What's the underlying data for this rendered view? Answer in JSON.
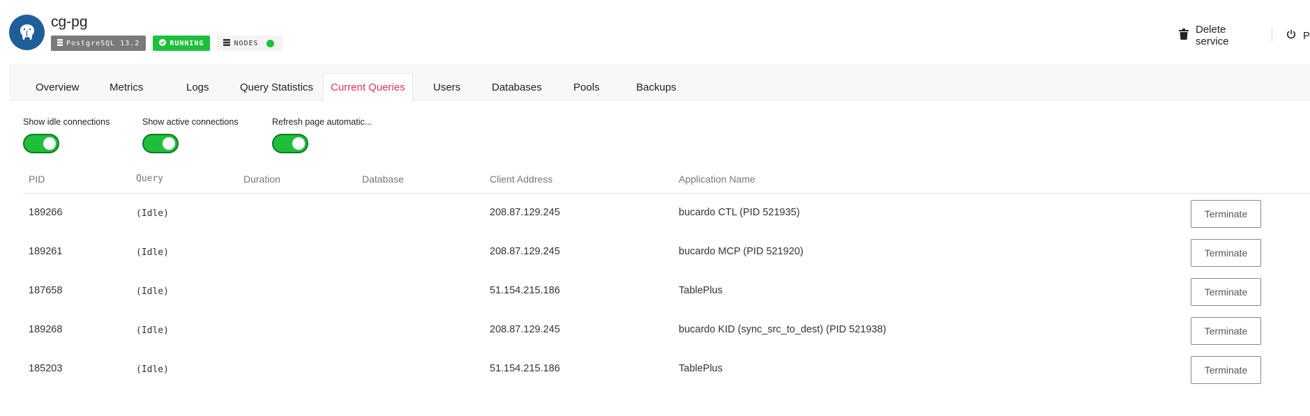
{
  "service": {
    "title": "cg-pg",
    "badges": {
      "version": "PostgreSQL 13.2",
      "status": "RUNNING",
      "nodes": "NODES"
    },
    "colors": {
      "accent": "#e8315a",
      "running": "#1fbf3c",
      "avatar": "#1e5f99"
    }
  },
  "actions": {
    "delete_label": "Delete service",
    "power_label": "P"
  },
  "tabs": [
    {
      "label": "Overview"
    },
    {
      "label": "Metrics"
    },
    {
      "label": "Logs"
    },
    {
      "label": "Query Statistics"
    },
    {
      "label": "Current Queries",
      "active": true
    },
    {
      "label": "Users"
    },
    {
      "label": "Databases"
    },
    {
      "label": "Pools"
    },
    {
      "label": "Backups"
    }
  ],
  "toggles": [
    {
      "label": "Show idle connections",
      "on": true
    },
    {
      "label": "Show active connections",
      "on": true
    },
    {
      "label": "Refresh page automatic...",
      "on": true
    }
  ],
  "table": {
    "columns": {
      "pid": "PID",
      "query": "Query",
      "duration": "Duration",
      "database": "Database",
      "client_address": "Client Address",
      "application_name": "Application Name"
    },
    "rows": [
      {
        "pid": "189266",
        "query": "(Idle)",
        "duration": "",
        "database": "",
        "client_address": "208.87.129.245",
        "application_name": "bucardo CTL (PID 521935)",
        "action": "Terminate"
      },
      {
        "pid": "189261",
        "query": "(Idle)",
        "duration": "",
        "database": "",
        "client_address": "208.87.129.245",
        "application_name": "bucardo MCP (PID 521920)",
        "action": "Terminate"
      },
      {
        "pid": "187658",
        "query": "(Idle)",
        "duration": "",
        "database": "",
        "client_address": "51.154.215.186",
        "application_name": "TablePlus",
        "action": "Terminate"
      },
      {
        "pid": "189268",
        "query": "(Idle)",
        "duration": "",
        "database": "",
        "client_address": "208.87.129.245",
        "application_name": "bucardo KID (sync_src_to_dest) (PID 521938)",
        "action": "Terminate"
      },
      {
        "pid": "185203",
        "query": "(Idle)",
        "duration": "",
        "database": "",
        "client_address": "51.154.215.186",
        "application_name": "TablePlus",
        "action": "Terminate"
      }
    ]
  },
  "icons": {
    "avatar": "postgres-elephant-icon",
    "version": "database-icon",
    "status": "check-circle-icon",
    "nodes": "server-stack-icon",
    "delete": "trash-icon",
    "power": "power-icon"
  }
}
